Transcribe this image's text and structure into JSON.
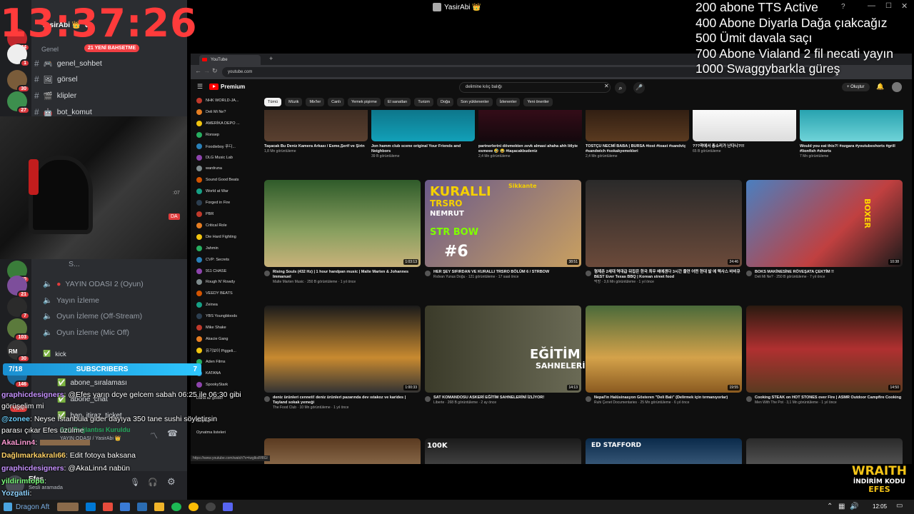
{
  "overlay": {
    "clock": "13:37:26",
    "goals": [
      "200 abone TTS Active",
      "400 Abone Diyarla Dağa çıakcağız",
      "500 Ümit davala saçı",
      "700 Abone Vialand 2 fil necati yayın",
      "1000 Swaggybarkla güreş"
    ],
    "sponsor_brand": "WRAITH",
    "sponsor_code": "İNDİRİM KODU",
    "sponsor_name": "EFES"
  },
  "window": {
    "title": "YasirAbi 👑"
  },
  "discord": {
    "server": "YasirAbi 👑",
    "category": "Genel",
    "banner": "21 YENİ BAHSETME",
    "guild_badges": [
      "844",
      "1",
      "30",
      "27",
      "30",
      "21",
      "7",
      "103",
      "30",
      "146"
    ],
    "text_channels": [
      "genel_sohbet",
      "görsel",
      "klipler",
      "bot_komut"
    ],
    "voice_channels": [
      "YAYIN ODASI 2 (Oyun)",
      "Yayın İzleme",
      "Oyun İzleme (Off-Stream)",
      "Oyun İzleme (Mic Off)"
    ],
    "channel_partial": "S...",
    "more_channels": [
      "kick",
      "abone_sıralaması",
      "abone_chat",
      "ban_itiraz_ticket"
    ],
    "voice_status": "Ses Bağlantısı Kuruldu",
    "voice_room": "YAYIN ODASI / YasirAbi 👑",
    "user_name": "Efes",
    "user_status": "Sesli aramada",
    "cam_time": ":07",
    "cam_tag": "DA",
    "yeni": "YENİ",
    "rm": "RM"
  },
  "subs_bar": {
    "left": "7/18",
    "label": "SUBSCRIBERS",
    "right": "7"
  },
  "chat": [
    {
      "user": "graphicdesigners",
      "color": "#c792ff",
      "text": ": @Efes yarın dcye gelcem sabah 06:25 ile 06:30 gibi"
    },
    {
      "user": "",
      "color": "#fff",
      "text": "görüşelim mi"
    },
    {
      "user": "@zonee",
      "color": "#6bd0ff",
      "text": ": Neyse İstanbula gider dayıya 350 tane sushi söyletirsin"
    },
    {
      "user": "",
      "color": "#fff",
      "text": "parası çıkar Efes üzülme"
    },
    {
      "user": "AkaLinn4",
      "color": "#ff9ad5",
      "text": ":"
    },
    {
      "user": "Dağlımarkakralı66",
      "color": "#ffd166",
      "text": ": Edit fotoya baksana"
    },
    {
      "user": "graphicdesigners",
      "color": "#c792ff",
      "text": ": @AkaLinn4 nabün"
    },
    {
      "user": "yildirimtopu",
      "color": "#7cff7c",
      "text": ":"
    },
    {
      "user": "Yozgatli",
      "color": "#8fd3ff",
      "text": ":"
    }
  ],
  "browser": {
    "tab_title": "YouTube",
    "url": "youtube.com",
    "search_query": "delimine kılıç balığı",
    "premium_label": "Premium",
    "create_label": "Oluştur",
    "status_url": "https://www.youtube.com/watch?v=iwglksRf8Gl",
    "chips": [
      "Tümü",
      "Müzik",
      "Mix'ler",
      "Canlı",
      "Yemek pişirme",
      "El sanatları",
      "Turizm",
      "Doğa",
      "Son yüklenenler",
      "İzlenenler",
      "Yeni öneriler"
    ],
    "subscriptions": [
      "NHK WORLD-JA...",
      "Deli Mi Ne?",
      "AMERİKA DEPO ...",
      "Ronsep",
      "Foodieboy 푸디...",
      "DLG Music Lab",
      "wardruna",
      "Sound Good Beats",
      "World at War",
      "Forged in Fire",
      "PBR",
      "Critical Role",
      "Die Hard Fighting",
      "Jahmin",
      "CVP: Secrets",
      "911 CHASE",
      "Rough N' Rowdy",
      "VEEDY BEATS",
      "Zeinea",
      "YBS Youngbloods",
      "Mike Shake",
      "Akacie Gang",
      "유기보이 Piggeli...",
      "Aden Films",
      "KATANA",
      "SpookyStark"
    ],
    "side_more": "Daha az göster",
    "side_settings": "Geçmiş",
    "side_playlist": "Oynatma listeleri",
    "rows": [
      [
        {
          "title": "Taşacak Bu Deniz Kamera Arkası / Esme,Şerif ve Şirin",
          "meta": "1,8 Mn görüntüleme"
        },
        {
          "title": "Jon hamm club scene original Your Friends and Neighbors",
          "meta": "39 B görüntüleme"
        },
        {
          "title": "partnerlerini dövmekten zevk almasi ahaha ahh litlyie esmeee 🤣 😂 #taşacakbudeniz",
          "meta": "2,4 Mn görüntüleme"
        },
        {
          "title": "TOSTÇU NECMİ BABA | BURSA #tost #toast #sandviç #sandwich #sokakyemekleri",
          "meta": "2,4 Mn görüntüleme"
        },
        {
          "title": "???곽에서 총소리가 난다니?!!!",
          "meta": "65 B görüntüleme"
        },
        {
          "title": "Would you eat this?! #ozgara #youtubeshorts #grill #lionfish #shorts",
          "meta": "7 Mn görüntüleme"
        }
      ],
      [
        {
          "title": "Rising Souls (432 Hz) | 1 hour handpan music | Malte Marten & Johannes Immanuel",
          "meta": "Malte Marten Music · 250 B görüntüleme · 1 yıl önce",
          "dur": "1:03:13"
        },
        {
          "title": "HER ŞEY SIFIRDAN VE KURALLI TRSRO BÖLÜM 6 / STRBOW",
          "meta": "Rıdvan Yunus Doğu · 121 görüntüleme · 17 saat önce",
          "dur": "38:51"
        },
        {
          "title": "형제촌 2세대 역대급 뒤집은 한국 최우 배에겐다 3시간 줄연 어떤 현대 발 에 텍사스 바비큐 BEST Ever Texas BBQ | Korean street food",
          "meta": "먹방 · 3,6 Mn görüntüleme · 1 yıl önce",
          "dur": "24:46"
        },
        {
          "title": "BOKS MAKİNESİNE RÖVEŞATA ÇEKTİM !!",
          "meta": "Deli Mi Ne? · 250 B görüntüleme · 7 yıl önce",
          "dur": "10:38"
        }
      ],
      [
        {
          "title": "deniz ürünleri cenneti! deniz ürünleri pazarında dev ıstakoz ve karides | Tayland sokak yemeği",
          "meta": "The Food Club · 10 Mn görüntüleme · 1 yıl önce",
          "dur": "1:00:33"
        },
        {
          "title": "SAT KOMANDOSU ASKERİ EĞİTİM SAHNELERİNİ İZLİYOR!",
          "meta": "Liberte · 268 B görüntüleme · 2 ay önce",
          "dur": "14:13"
        },
        {
          "title": "Nepal'in Halüsinasyon Gösteren \"Deli Balı\" (Delirmek için tırmanıyorlar)",
          "meta": "Ruhi Çenet Documentaries · 25 Mn görüntüleme · 6 yıl önce",
          "dur": "19:55"
        },
        {
          "title": "Cooking STEAK on HOT STONES over Fire | ASMR Outdoor Campfire Cooking",
          "meta": "Men With The Pot · 3,1 Mn görüntüleme · 1 yıl önce",
          "dur": "14:50"
        }
      ]
    ],
    "thumb_texts": {
      "kuralli": "KURALLI",
      "trsro": "TRSRO",
      "nemrut": "NEMRUT",
      "strbow": "STR BOW",
      "six": "#6",
      "sikkante": "Sikkante",
      "sahneleri": "SAHNELERİ",
      "egitim": "EĞİTİM",
      "boxer": "BOXER",
      "edstafford": "ED STAFFORD",
      "hundredk": "100K"
    }
  },
  "taskbar": {
    "time": "12:05",
    "app_label": "Dragon Aft"
  }
}
